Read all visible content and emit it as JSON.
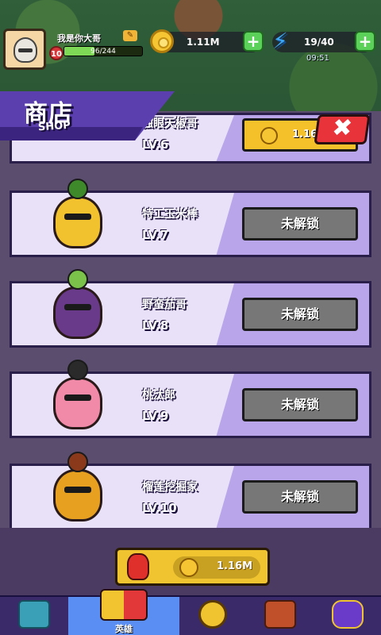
{
  "player": {
    "name": "我是你大哥",
    "level": "10",
    "xp": "96/244",
    "xp_ratio": 0.39
  },
  "resources": {
    "gold": "1.11M",
    "energy": "19/40",
    "timer": "09:51"
  },
  "shop": {
    "title": "商店",
    "subtitle": "SHOP",
    "close_label": "✖"
  },
  "heroes": [
    {
      "name": "独眼天椒哥",
      "level": "LV.6",
      "action": "1.16M",
      "locked": false
    },
    {
      "name": "特工玉米棒",
      "level": "LV.7",
      "action": "未解锁",
      "locked": true
    },
    {
      "name": "野蛮茄哥",
      "level": "LV.8",
      "action": "未解锁",
      "locked": true
    },
    {
      "name": "桃汰郎",
      "level": "LV.9",
      "action": "未解锁",
      "locked": true
    },
    {
      "name": "榴莲挖掘家",
      "level": "LV.10",
      "action": "未解锁",
      "locked": true
    }
  ],
  "bottom_price": "1.16M",
  "nav": {
    "active": "英雄",
    "items": [
      "treasure",
      "英雄",
      "compass",
      "backpack",
      "crown"
    ]
  },
  "colors": {
    "card_bg": "#b9a6ea",
    "shop_purple": "#5b3fae",
    "locked_btn": "#777777",
    "buy_btn": "#f4c12b",
    "close_btn": "#e8333a"
  }
}
